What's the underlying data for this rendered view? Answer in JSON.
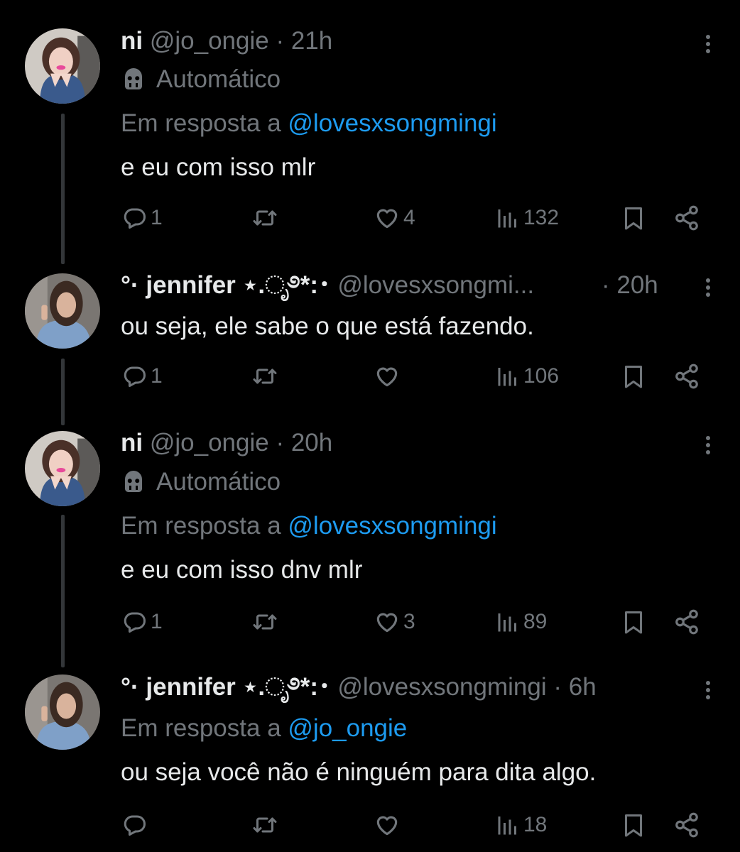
{
  "tweets": [
    {
      "name": "ni",
      "handle": "@jo_ongie",
      "time": "· 21h",
      "automated_label": "Automático",
      "reply_prefix": "Em resposta a",
      "reply_to": "@lovesxsongmingi",
      "text": "e eu com isso mlr",
      "replies": "1",
      "retweets": "",
      "likes": "4",
      "views": "132",
      "avatar": "pink-haired-girl"
    },
    {
      "name": "°· jennifer ⋆.ೃ࿔*:･",
      "handle": "@lovesxsongmi...",
      "time": "· 20h",
      "text": "ou seja, ele sabe o que está fazendo.",
      "replies": "1",
      "retweets": "",
      "likes": "",
      "views": "106",
      "avatar": "dark-haired-girl"
    },
    {
      "name": "ni",
      "handle": "@jo_ongie",
      "time": "· 20h",
      "automated_label": "Automático",
      "reply_prefix": "Em resposta a",
      "reply_to": "@lovesxsongmingi",
      "text": "e eu com isso dnv mlr",
      "replies": "1",
      "retweets": "",
      "likes": "3",
      "views": "89",
      "avatar": "pink-haired-girl"
    },
    {
      "name": "°· jennifer ⋆.ೃ࿔*:･",
      "handle": "@lovesxsongmingi",
      "time": "· 6h",
      "reply_prefix": "Em resposta a",
      "reply_to": "@jo_ongie",
      "text": "ou seja você não é ninguém para dita algo.",
      "replies": "",
      "retweets": "",
      "likes": "",
      "views": "18",
      "avatar": "dark-haired-girl"
    }
  ],
  "icons": {
    "reply": "reply-icon",
    "retweet": "retweet-icon",
    "like": "heart-icon",
    "views": "views-icon",
    "bookmark": "bookmark-icon",
    "share": "share-icon",
    "more": "more-icon",
    "automated": "bot-icon"
  },
  "colors": {
    "background": "#000000",
    "text": "#e7e9ea",
    "muted": "#71767b",
    "link": "#1d9bf0"
  }
}
